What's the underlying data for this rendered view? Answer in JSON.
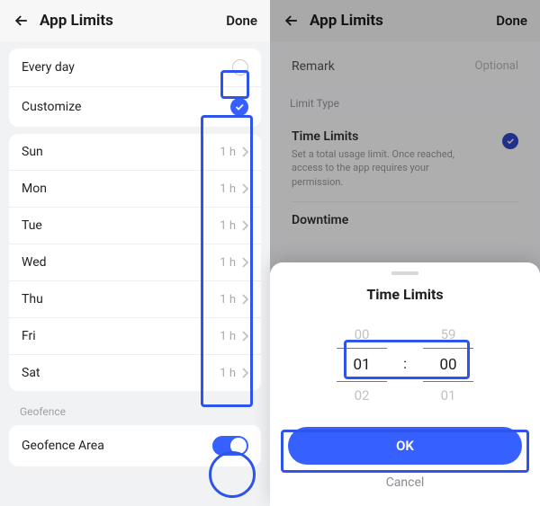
{
  "left": {
    "header": {
      "title": "App Limits",
      "done": "Done"
    },
    "schedule_options": {
      "every_day": "Every day",
      "customize": "Customize"
    },
    "days": [
      {
        "label": "Sun",
        "value": "1 h"
      },
      {
        "label": "Mon",
        "value": "1 h"
      },
      {
        "label": "Tue",
        "value": "1 h"
      },
      {
        "label": "Wed",
        "value": "1 h"
      },
      {
        "label": "Thu",
        "value": "1 h"
      },
      {
        "label": "Fri",
        "value": "1 h"
      },
      {
        "label": "Sat",
        "value": "1 h"
      }
    ],
    "geofence": {
      "section": "Geofence",
      "label": "Geofence Area",
      "enabled": true
    }
  },
  "right": {
    "header": {
      "title": "App Limits",
      "done": "Done"
    },
    "remark": {
      "label": "Remark",
      "placeholder": "Optional"
    },
    "limit_type_section": "Limit Type",
    "time_limits": {
      "title": "Time Limits",
      "desc": "Set a total usage limit. Once reached, access to the app requires your permission."
    },
    "downtime": {
      "title": "Downtime"
    },
    "sheet": {
      "title": "Time Limits",
      "hours": {
        "prev": "00",
        "sel": "01",
        "next": "02"
      },
      "minutes": {
        "prev": "59",
        "sel": "00",
        "next": "01"
      },
      "colon": ":",
      "ok": "OK",
      "cancel": "Cancel"
    }
  }
}
